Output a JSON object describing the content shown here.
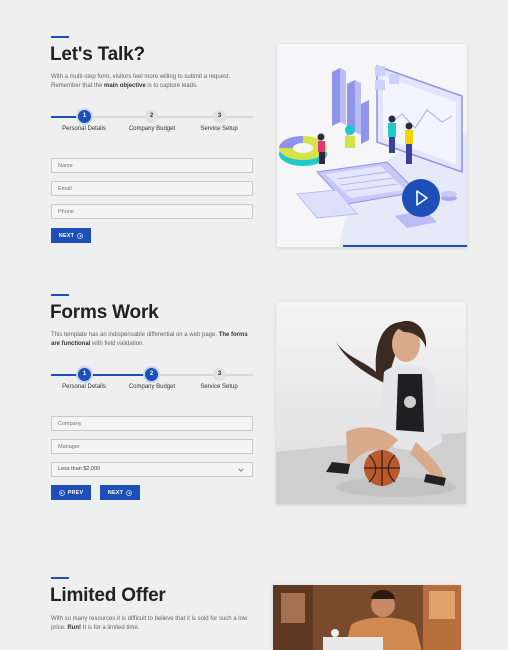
{
  "section1": {
    "title": "Let's Talk?",
    "desc_part1": "With a multi-step form, visitors feel more willing to submit a request. Remember that the ",
    "desc_bold": "main objective",
    "desc_part2": " is to capture leads.",
    "steps": [
      {
        "num": "1",
        "label": "Personal Details"
      },
      {
        "num": "2",
        "label": "Company Budget"
      },
      {
        "num": "3",
        "label": "Service Setup"
      }
    ],
    "fields": [
      {
        "placeholder": "Name"
      },
      {
        "placeholder": "Email"
      },
      {
        "placeholder": "Phone"
      }
    ],
    "next_label": "NEXT",
    "illustration": "isometric-office-illustration",
    "play_icon": "play-icon"
  },
  "section2": {
    "title": "Forms Work",
    "desc_part1": "This template has an indispensable differential on a web page. ",
    "desc_bold": "The forms are functional",
    "desc_part2": " with field validation.",
    "steps": [
      {
        "num": "1",
        "label": "Personal Details"
      },
      {
        "num": "2",
        "label": "Company Budget"
      },
      {
        "num": "3",
        "label": "Service Setup"
      }
    ],
    "fields": [
      {
        "placeholder": "Company"
      },
      {
        "placeholder": "Manager"
      }
    ],
    "select_value": "Less than $2,000",
    "prev_label": "PREV",
    "next_label": "NEXT",
    "photo": "basketball-player-photo"
  },
  "section3": {
    "title": "Limited Offer",
    "desc_part1": "With so many resources it is difficult to believe that it is sold for such a low price. ",
    "desc_bold": "Run!",
    "desc_part2": " It is for a limited time.",
    "photo": "office-worker-photo"
  },
  "colors": {
    "accent": "#1d4fb8",
    "background": "#efefef"
  }
}
